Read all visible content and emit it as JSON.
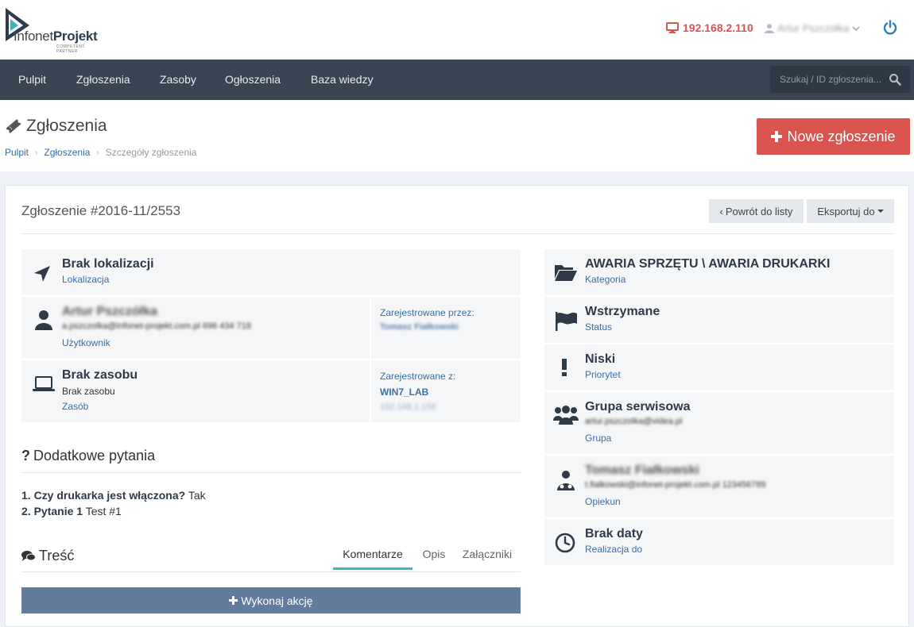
{
  "header": {
    "logo_light": "Infonet",
    "logo_bold": "Projekt",
    "logo_tagline": "COMPETENT PARTNER",
    "ip_address": "192.168.2.110",
    "user_name": "Artur Pszczółka"
  },
  "nav": {
    "items": [
      "Pulpit",
      "Zgłoszenia",
      "Zasoby",
      "Ogłoszenia",
      "Baza wiedzy"
    ],
    "search_placeholder": "Szukaj / ID zgłoszenia..."
  },
  "page": {
    "title": "Zgłoszenia",
    "breadcrumb": [
      "Pulpit",
      "Zgłoszenia",
      "Szczegóły zgłoszenia"
    ],
    "new_button": "Nowe zgłoszenie"
  },
  "ticket": {
    "title": "Zgłoszenie #2016-11/2553",
    "back_button": "Powrót do listy",
    "export_button": "Eksportuj do",
    "location": {
      "title": "Brak lokalizacji",
      "label": "Lokalizacja"
    },
    "user": {
      "name": "Artur Pszczółka",
      "contact": "a.pszczolka@infonet-projekt.com.pl 696 434 718",
      "label": "Użytkownik"
    },
    "registered_by": {
      "label": "Zarejestrowane przez:",
      "value": "Tomasz Fiałkowski"
    },
    "resource": {
      "title": "Brak zasobu",
      "sub": "Brak zasobu",
      "label": "Zasób"
    },
    "registered_from": {
      "label": "Zarejestrowane z:",
      "host": "WIN7_LAB",
      "ip": "192.168.1.158"
    },
    "category": {
      "title": "AWARIA SPRZĘTU \\ AWARIA DRUKARKI",
      "label": "Kategoria"
    },
    "status": {
      "title": "Wstrzymane",
      "label": "Status"
    },
    "priority": {
      "title": "Niski",
      "label": "Priorytet"
    },
    "group": {
      "title": "Grupa serwisowa",
      "contact": "artur.pszczolka@videa.pl",
      "label": "Grupa"
    },
    "caretaker": {
      "name": "Tomasz Fiałkowski",
      "contact": "t.fialkowski@infonet-projekt.com.pl 123456789",
      "label": "Opiekun"
    },
    "due": {
      "title": "Brak daty",
      "label": "Realizacja do"
    }
  },
  "questions": {
    "title": "Dodatkowe pytania",
    "items": [
      {
        "q": "1. Czy drukarka jest włączona?",
        "a": "Tak"
      },
      {
        "q": "2. Pytanie 1",
        "a": "Test #1"
      }
    ]
  },
  "content": {
    "title": "Treść",
    "tabs": [
      "Komentarze",
      "Opis",
      "Załączniki"
    ],
    "action_button": "Wykonaj akcję"
  }
}
